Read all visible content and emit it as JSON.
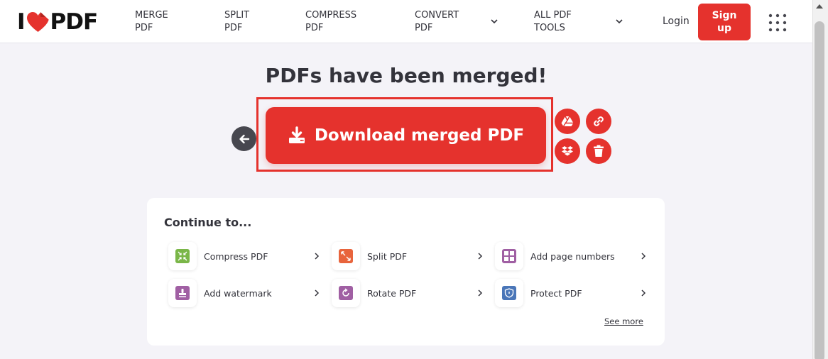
{
  "header": {
    "logo": {
      "left": "I",
      "right": "PDF",
      "heart_color": "#e5322d"
    },
    "nav": [
      {
        "label": "MERGE\nPDF",
        "has_dropdown": false
      },
      {
        "label": "SPLIT\nPDF",
        "has_dropdown": false
      },
      {
        "label": "COMPRESS\nPDF",
        "has_dropdown": false
      },
      {
        "label": "CONVERT\nPDF",
        "has_dropdown": true
      },
      {
        "label": "ALL PDF\nTOOLS",
        "has_dropdown": true
      }
    ],
    "login_label": "Login",
    "signup_label": "Sign\nup",
    "apps_icon": "grid-icon"
  },
  "main": {
    "title": "PDFs have been merged!",
    "download_label": "Download merged PDF",
    "accent_color": "#e5322d",
    "side_actions": [
      {
        "name": "google-drive",
        "icon": "google-drive-icon"
      },
      {
        "name": "copy-link",
        "icon": "link-icon"
      },
      {
        "name": "dropbox",
        "icon": "dropbox-icon"
      },
      {
        "name": "delete",
        "icon": "trash-icon"
      }
    ]
  },
  "continue": {
    "title": "Continue to...",
    "tools": [
      {
        "label": "Compress PDF",
        "icon": "compress-icon",
        "color": "#7ab648"
      },
      {
        "label": "Split PDF",
        "icon": "split-icon",
        "color": "#e8643c"
      },
      {
        "label": "Add page numbers",
        "icon": "page-numbers-icon",
        "color": "#a05fa3"
      },
      {
        "label": "Add watermark",
        "icon": "watermark-icon",
        "color": "#a05fa3"
      },
      {
        "label": "Rotate PDF",
        "icon": "rotate-icon",
        "color": "#a05fa3"
      },
      {
        "label": "Protect PDF",
        "icon": "protect-icon",
        "color": "#4a76b8"
      }
    ],
    "see_more": "See more"
  }
}
